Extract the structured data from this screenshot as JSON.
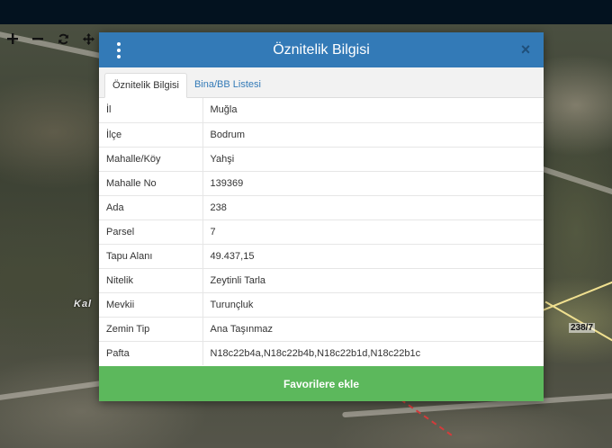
{
  "map": {
    "place_label": "Kal",
    "parcel_label": "238/7"
  },
  "toolbar": {
    "tools": [
      {
        "name": "zoom-in",
        "icon": "plus-icon"
      },
      {
        "name": "zoom-out",
        "icon": "minus-icon"
      },
      {
        "name": "refresh",
        "icon": "refresh-icon"
      },
      {
        "name": "pan",
        "icon": "move-icon"
      }
    ]
  },
  "modal": {
    "title": "Öznitelik Bilgisi",
    "menu_icon": "vertical-dots-icon",
    "close_icon": "close-icon",
    "tabs": [
      {
        "label": "Öznitelik Bilgisi",
        "active": true
      },
      {
        "label": "Bina/BB Listesi",
        "active": false
      }
    ],
    "rows": [
      {
        "key": "İl",
        "value": "Muğla"
      },
      {
        "key": "İlçe",
        "value": "Bodrum"
      },
      {
        "key": "Mahalle/Köy",
        "value": "Yahşi"
      },
      {
        "key": "Mahalle No",
        "value": "139369"
      },
      {
        "key": "Ada",
        "value": "238"
      },
      {
        "key": "Parsel",
        "value": "7"
      },
      {
        "key": "Tapu Alanı",
        "value": "49.437,15"
      },
      {
        "key": "Nitelik",
        "value": "Zeytinli Tarla"
      },
      {
        "key": "Mevkii",
        "value": "Turunçluk"
      },
      {
        "key": "Zemin Tip",
        "value": "Ana Taşınmaz"
      },
      {
        "key": "Pafta",
        "value": "N18c22b4a,N18c22b4b,N18c22b1d,N18c22b1c"
      }
    ],
    "favorite_button": "Favorilere ekle"
  },
  "colors": {
    "header": "#337ab7",
    "favorite": "#5cb85c",
    "topbar": "#03121f"
  }
}
